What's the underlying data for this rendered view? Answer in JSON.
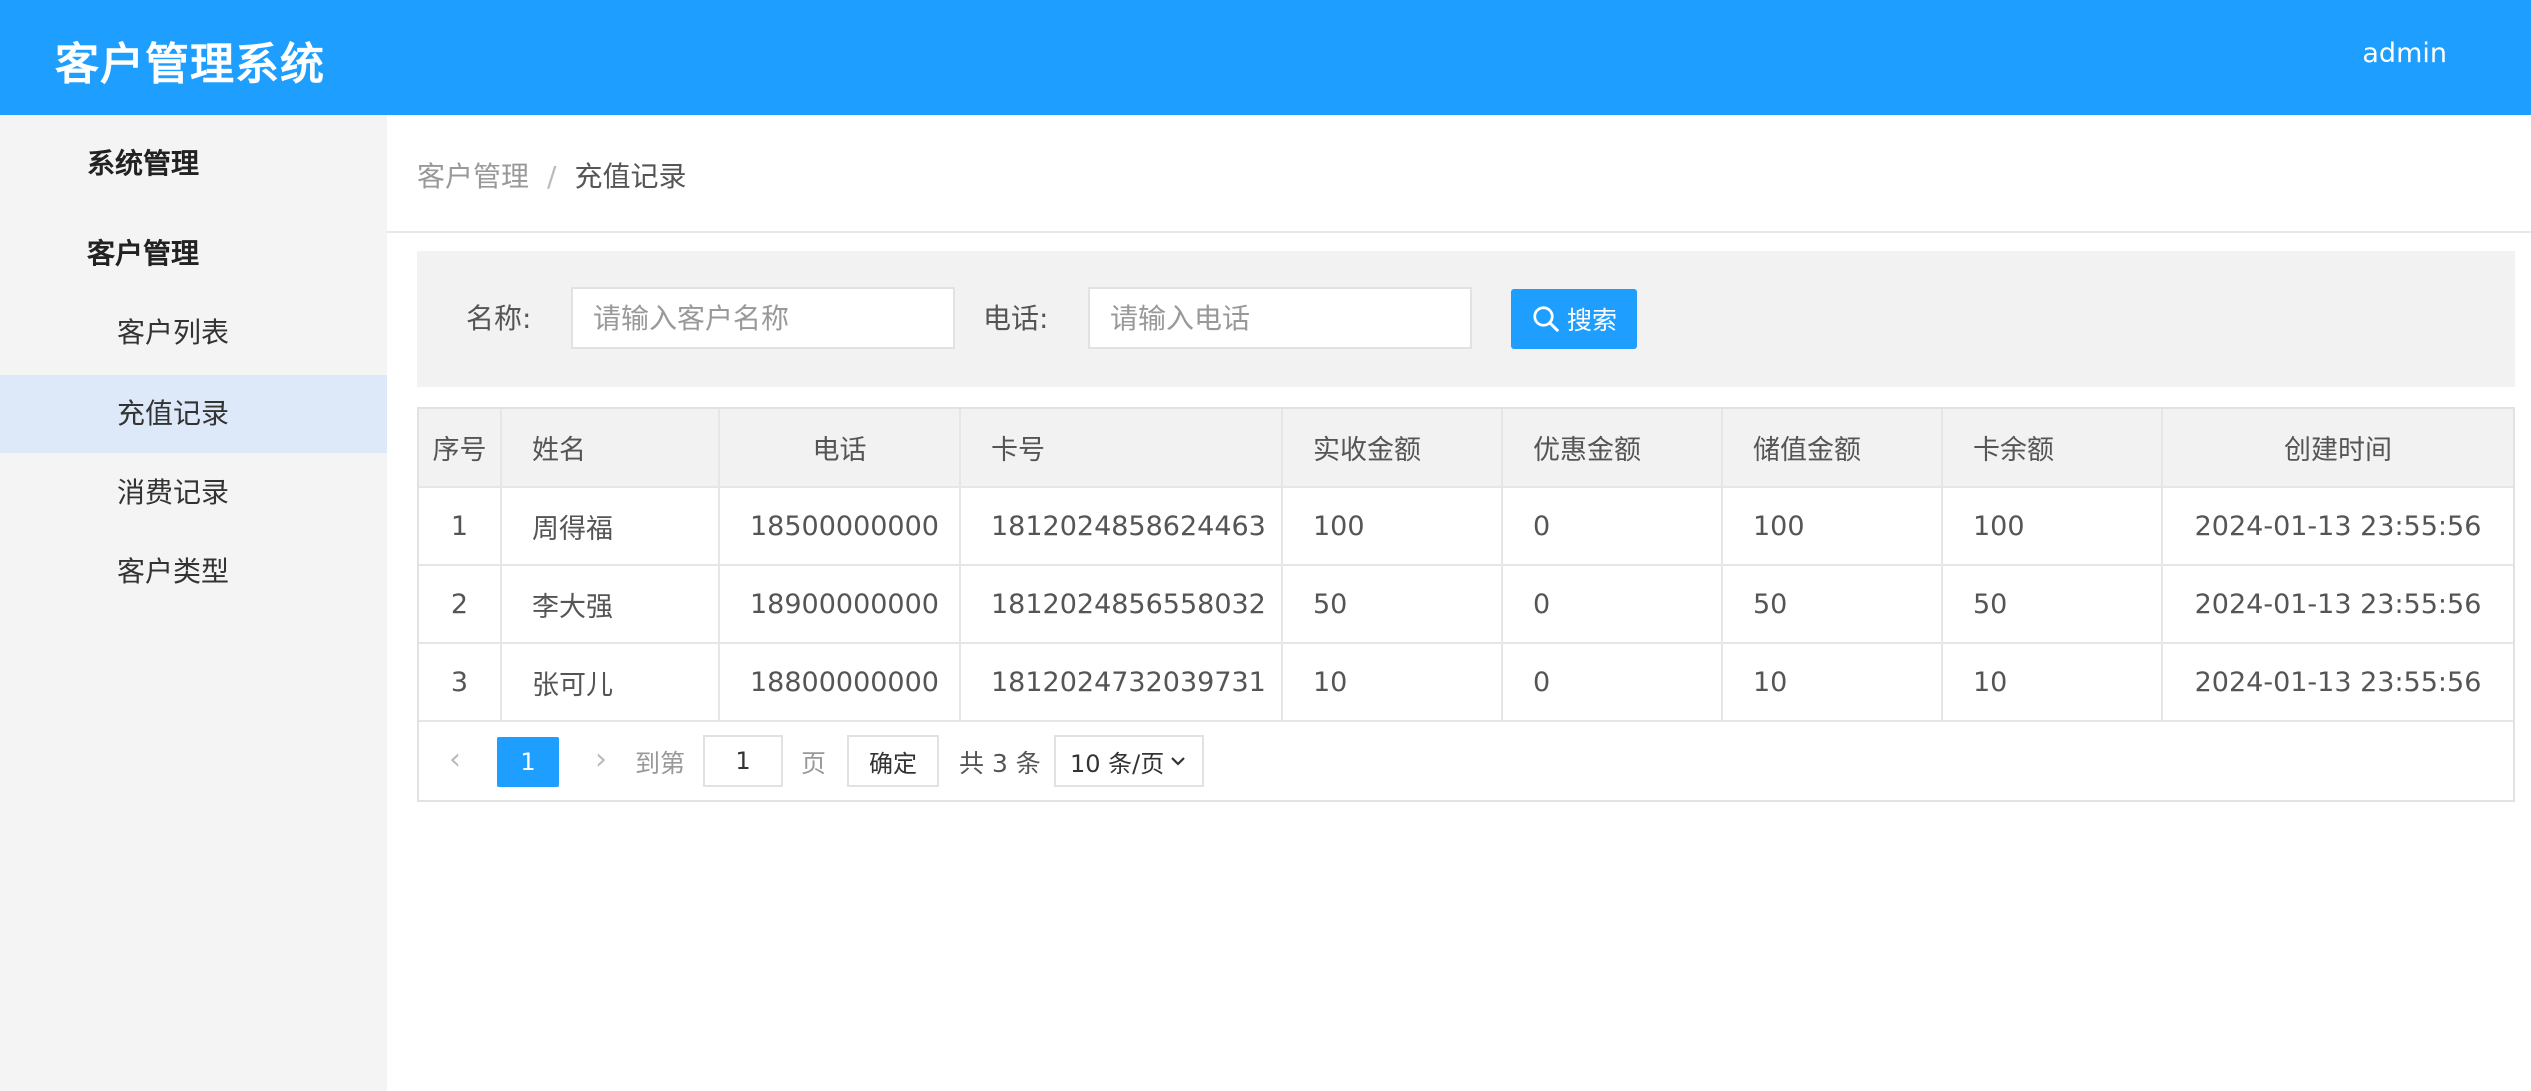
{
  "header": {
    "title": "客户管理系统",
    "user": "admin"
  },
  "sidebar": {
    "group_system": "系统管理",
    "group_customer": "客户管理",
    "items": [
      "客户列表",
      "充值记录",
      "消费记录",
      "客户类型"
    ],
    "active_index": 1
  },
  "breadcrumb": {
    "parent": "客户管理",
    "separator": "/",
    "current": "充值记录"
  },
  "search": {
    "name_label": "名称:",
    "name_placeholder": "请输入客户名称",
    "phone_label": "电话:",
    "phone_placeholder": "请输入电话",
    "button_label": "搜索"
  },
  "table": {
    "columns": [
      "序号",
      "姓名",
      "电话",
      "卡号",
      "实收金额",
      "优惠金额",
      "储值金额",
      "卡余额",
      "创建时间"
    ],
    "rows": [
      [
        "1",
        "周得福",
        "18500000000",
        "1812024858624463",
        "100",
        "0",
        "100",
        "100",
        "2024-01-13 23:55:56"
      ],
      [
        "2",
        "李大强",
        "18900000000",
        "1812024856558032",
        "50",
        "0",
        "50",
        "50",
        "2024-01-13 23:55:56"
      ],
      [
        "3",
        "张可儿",
        "18800000000",
        "1812024732039731",
        "10",
        "0",
        "10",
        "10",
        "2024-01-13 23:55:56"
      ]
    ]
  },
  "pager": {
    "current_page": "1",
    "goto_label": "到第",
    "page_value": "1",
    "page_unit": "页",
    "confirm_label": "确定",
    "total_text": "共 3 条",
    "page_size": "10 条/页"
  },
  "colors": {
    "primary": "#1e9fff",
    "sidebar_bg": "#f4f4f4",
    "active_item_bg": "#dde8f8"
  }
}
